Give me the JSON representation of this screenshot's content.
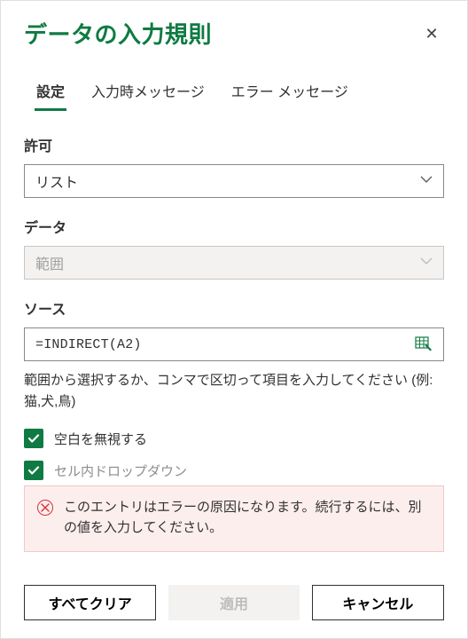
{
  "header": {
    "title": "データの入力規則",
    "close_glyph": "✕"
  },
  "tabs": {
    "settings": "設定",
    "input_message": "入力時メッセージ",
    "error_message": "エラー メッセージ"
  },
  "allow": {
    "label": "許可",
    "value": "リスト"
  },
  "data": {
    "label": "データ",
    "value": "範囲"
  },
  "source": {
    "label": "ソース",
    "value": "=INDIRECT(A2)",
    "hint": "範囲から選択するか、コンマで区切って項目を入力してください (例: 猫,犬,鳥)"
  },
  "options": {
    "ignore_blank": "空白を無視する",
    "in_cell_dropdown": "セル内ドロップダウン"
  },
  "error_banner": {
    "text": "このエントリはエラーの原因になります。続行するには、別の値を入力してください。"
  },
  "footer": {
    "clear_all": "すべてクリア",
    "apply": "適用",
    "cancel": "キャンセル"
  },
  "icons": {
    "chevron_down": "⌄",
    "checkmark": "✓",
    "error": "✕"
  }
}
